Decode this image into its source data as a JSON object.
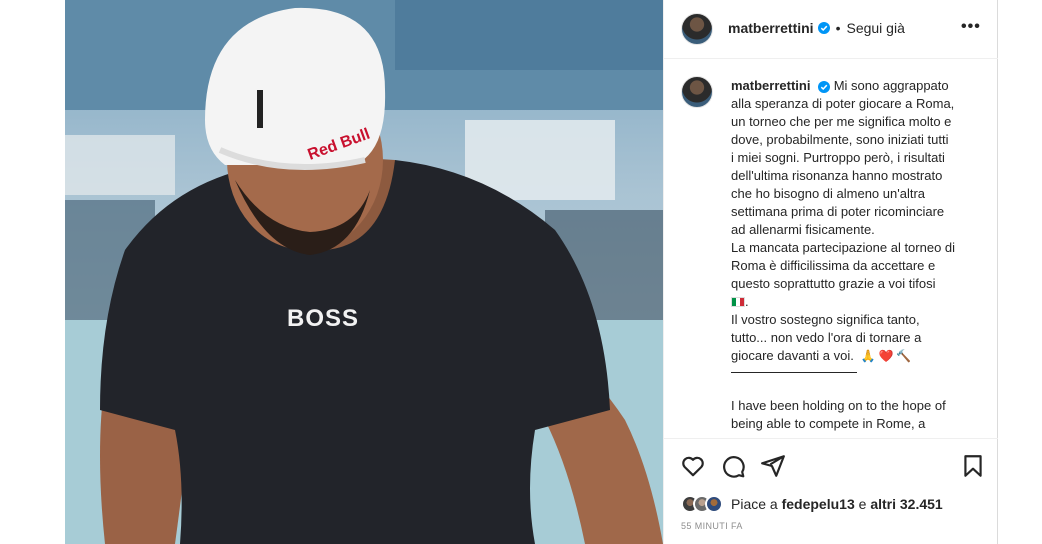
{
  "post": {
    "username": "matberrettini",
    "follow_status": "Segui già",
    "more_icon": "more-horizontal-icon",
    "verified_color": "#0095f6"
  },
  "photo": {
    "cap_text": "Red Bull",
    "shirt_text": "BOSS"
  },
  "caption": {
    "lines_it": [
      "Mi sono aggrappato",
      "alla speranza di poter giocare a Roma,",
      "un torneo che per me significa molto e",
      "dove, probabilmente, sono iniziati tutti",
      "i miei sogni. Purtroppo però, i risultati",
      "dell'ultima risonanza hanno mostrato",
      "che ho bisogno di almeno un'altra",
      "settimana prima di poter ricominciare",
      "ad allenarmi fisicamente.",
      "La mancata partecipazione al torneo di",
      "Roma è difficilissima da accettare e",
      "questo soprattutto grazie a voi tifosi"
    ],
    "flag_suffix": ".",
    "lines_it_2": [
      "Il vostro sostegno significa tanto,",
      "tutto... non vedo l'ora di tornare a"
    ],
    "last_line": "giocare davanti a voi.",
    "emojis": [
      "🙏",
      "❤️",
      "🔨"
    ],
    "lines_en": [
      "I have been holding on to the hope of",
      "being able to compete in Rome, a"
    ]
  },
  "actions": {
    "icons": [
      "heart-icon",
      "comment-icon",
      "share-icon",
      "bookmark-icon"
    ],
    "likes_prefix": "Piace a",
    "likes_user": "fedepelu13",
    "likes_middle": "e",
    "likes_count": "altri 32.451",
    "timestamp": "55 minuti fa"
  }
}
